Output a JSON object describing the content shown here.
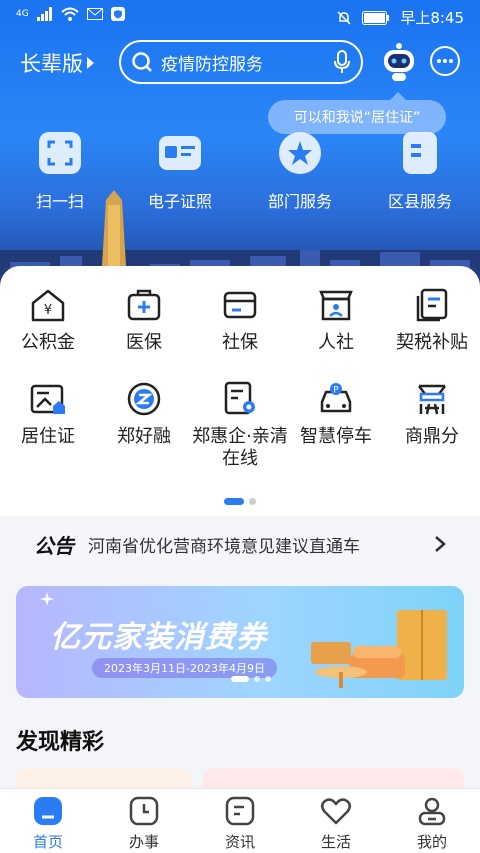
{
  "status_bar": {
    "network": "4G",
    "time": "早上8:45"
  },
  "header": {
    "elder_mode_label": "长辈版",
    "search_text": "疫情防控服务",
    "assistant_tip": "可以和我说“居住证”"
  },
  "quick_actions": [
    {
      "label": "扫一扫",
      "icon": "scan-icon"
    },
    {
      "label": "电子证照",
      "icon": "id-card-icon"
    },
    {
      "label": "部门服务",
      "icon": "department-icon"
    },
    {
      "label": "区县服务",
      "icon": "district-icon"
    }
  ],
  "services": [
    {
      "label": "公积金",
      "icon": "housing-fund-icon"
    },
    {
      "label": "医保",
      "icon": "medical-insurance-icon"
    },
    {
      "label": "社保",
      "icon": "social-security-icon"
    },
    {
      "label": "人社",
      "icon": "human-resources-icon"
    },
    {
      "label": "契税补贴",
      "icon": "deed-tax-icon"
    },
    {
      "label": "居住证",
      "icon": "residence-permit-icon"
    },
    {
      "label": "郑好融",
      "icon": "finance-icon"
    },
    {
      "label": "郑惠企·亲清在线",
      "icon": "enterprise-icon"
    },
    {
      "label": "智慧停车",
      "icon": "parking-icon"
    },
    {
      "label": "商鼎分",
      "icon": "credit-score-icon"
    }
  ],
  "notice": {
    "tag": "公告",
    "text": "河南省优化营商环境意见建议直通车"
  },
  "banner": {
    "title": "亿元家装消费券",
    "date_range": "2023年3月11日-2023年4月9日"
  },
  "discover": {
    "title": "发现精彩"
  },
  "tabbar": [
    {
      "label": "首页",
      "icon": "home-icon",
      "active": true
    },
    {
      "label": "办事",
      "icon": "clock-icon",
      "active": false
    },
    {
      "label": "资讯",
      "icon": "news-icon",
      "active": false
    },
    {
      "label": "生活",
      "icon": "heart-icon",
      "active": false
    },
    {
      "label": "我的",
      "icon": "profile-icon",
      "active": false
    }
  ],
  "colors": {
    "primary": "#2a7cf5",
    "header_bg": "#1a73f0"
  }
}
